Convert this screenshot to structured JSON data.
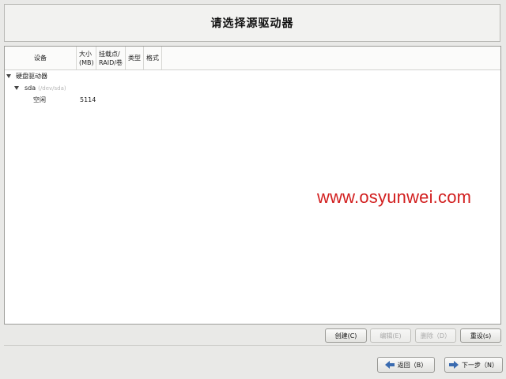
{
  "header": {
    "title": "请选择源驱动器"
  },
  "table": {
    "columns": [
      "设备",
      "大小\n(MB)",
      "挂载点/\nRAID/卷",
      "类型",
      "格式"
    ],
    "rows": [
      {
        "device": "硬盘驱动器"
      },
      {
        "device": "sda",
        "path": "(/dev/sda)"
      },
      {
        "device": "空闲",
        "size": "5114"
      }
    ]
  },
  "actions": {
    "create": "创建(C)",
    "edit": "编辑(E)",
    "delete": "删除（D）",
    "reset": "重设(s)"
  },
  "nav": {
    "back": "返回（B）",
    "next": "下一步（N）"
  },
  "watermark": "www.osyunwei.com",
  "colors": {
    "watermark": "#d21f1f",
    "nav_arrow": "#3a6bb0"
  },
  "icons": {
    "back": "arrow-left-icon",
    "next": "arrow-right-icon",
    "expand": "triangle-down-icon"
  }
}
